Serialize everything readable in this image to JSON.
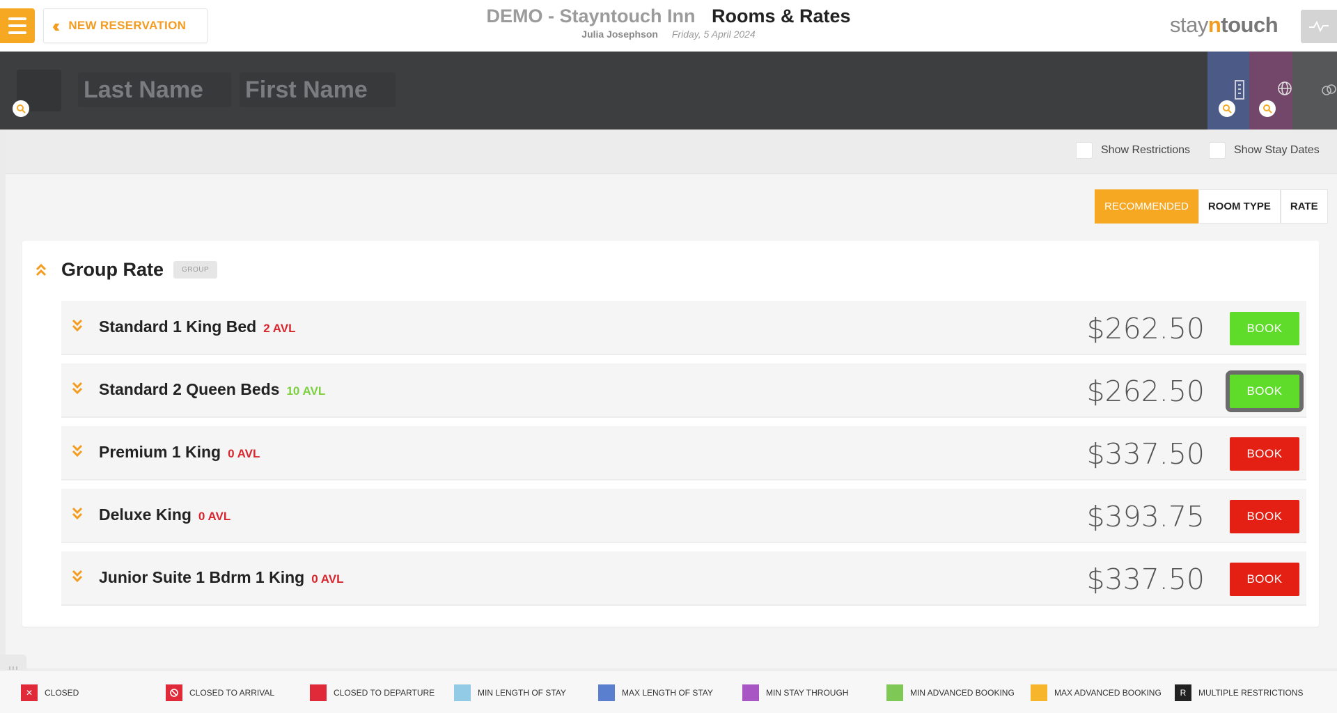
{
  "header": {
    "new_reservation": "NEW RESERVATION",
    "hotel_name": "DEMO - Stayntouch Inn",
    "page_title": "Rooms & Rates",
    "user": "Julia Josephson",
    "date": "Friday, 5 April 2024",
    "logo": {
      "stay": "stay",
      "n": "n",
      "touch": "touch"
    }
  },
  "search": {
    "last_name_placeholder": "Last Name",
    "first_name_placeholder": "First Name"
  },
  "options": {
    "show_restrictions": "Show Restrictions",
    "show_stay_dates": "Show Stay Dates"
  },
  "sort_tabs": [
    {
      "label": "RECOMMENDED",
      "active": true
    },
    {
      "label": "ROOM TYPE",
      "active": false
    },
    {
      "label": "RATE",
      "active": false
    }
  ],
  "group": {
    "title": "Group Rate",
    "badge": "GROUP",
    "rooms": [
      {
        "name": "Standard 1 King Bed",
        "avl": "2 AVL",
        "price": "$262.50",
        "book": "BOOK"
      },
      {
        "name": "Standard 2 Queen Beds",
        "avl": "10 AVL",
        "price": "$262.50",
        "book": "BOOK"
      },
      {
        "name": "Premium 1 King",
        "avl": "0 AVL",
        "price": "$337.50",
        "book": "BOOK"
      },
      {
        "name": "Deluxe King",
        "avl": "0 AVL",
        "price": "$393.75",
        "book": "BOOK"
      },
      {
        "name": "Junior Suite 1 Bdrm 1 King",
        "avl": "0 AVL",
        "price": "$337.50",
        "book": "BOOK"
      }
    ]
  },
  "legend": [
    {
      "label": "CLOSED",
      "color": "#e02a3a",
      "mark": "✕"
    },
    {
      "label": "CLOSED TO ARRIVAL",
      "color": "#e02a3a",
      "mark": "⃠"
    },
    {
      "label": "CLOSED TO DEPARTURE",
      "color": "#e02a3a",
      "mark": ""
    },
    {
      "label": "MIN LENGTH OF STAY",
      "color": "#92cbe6",
      "mark": ""
    },
    {
      "label": "MAX LENGTH OF STAY",
      "color": "#5b7fcf",
      "mark": ""
    },
    {
      "label": "MIN STAY THROUGH",
      "color": "#a856c4",
      "mark": ""
    },
    {
      "label": "MIN ADVANCED BOOKING",
      "color": "#7ec856",
      "mark": ""
    },
    {
      "label": "MAX ADVANCED BOOKING",
      "color": "#f7b52b",
      "mark": ""
    },
    {
      "label": "MULTIPLE RESTRICTIONS",
      "color": "#222222",
      "mark": "R"
    }
  ],
  "colors": {
    "accent": "#f7a823",
    "book_available": "#5fdc2a",
    "book_unavailable": "#e41f13",
    "avl_low": "#d9262e",
    "avl_ok": "#7ccf3f"
  }
}
